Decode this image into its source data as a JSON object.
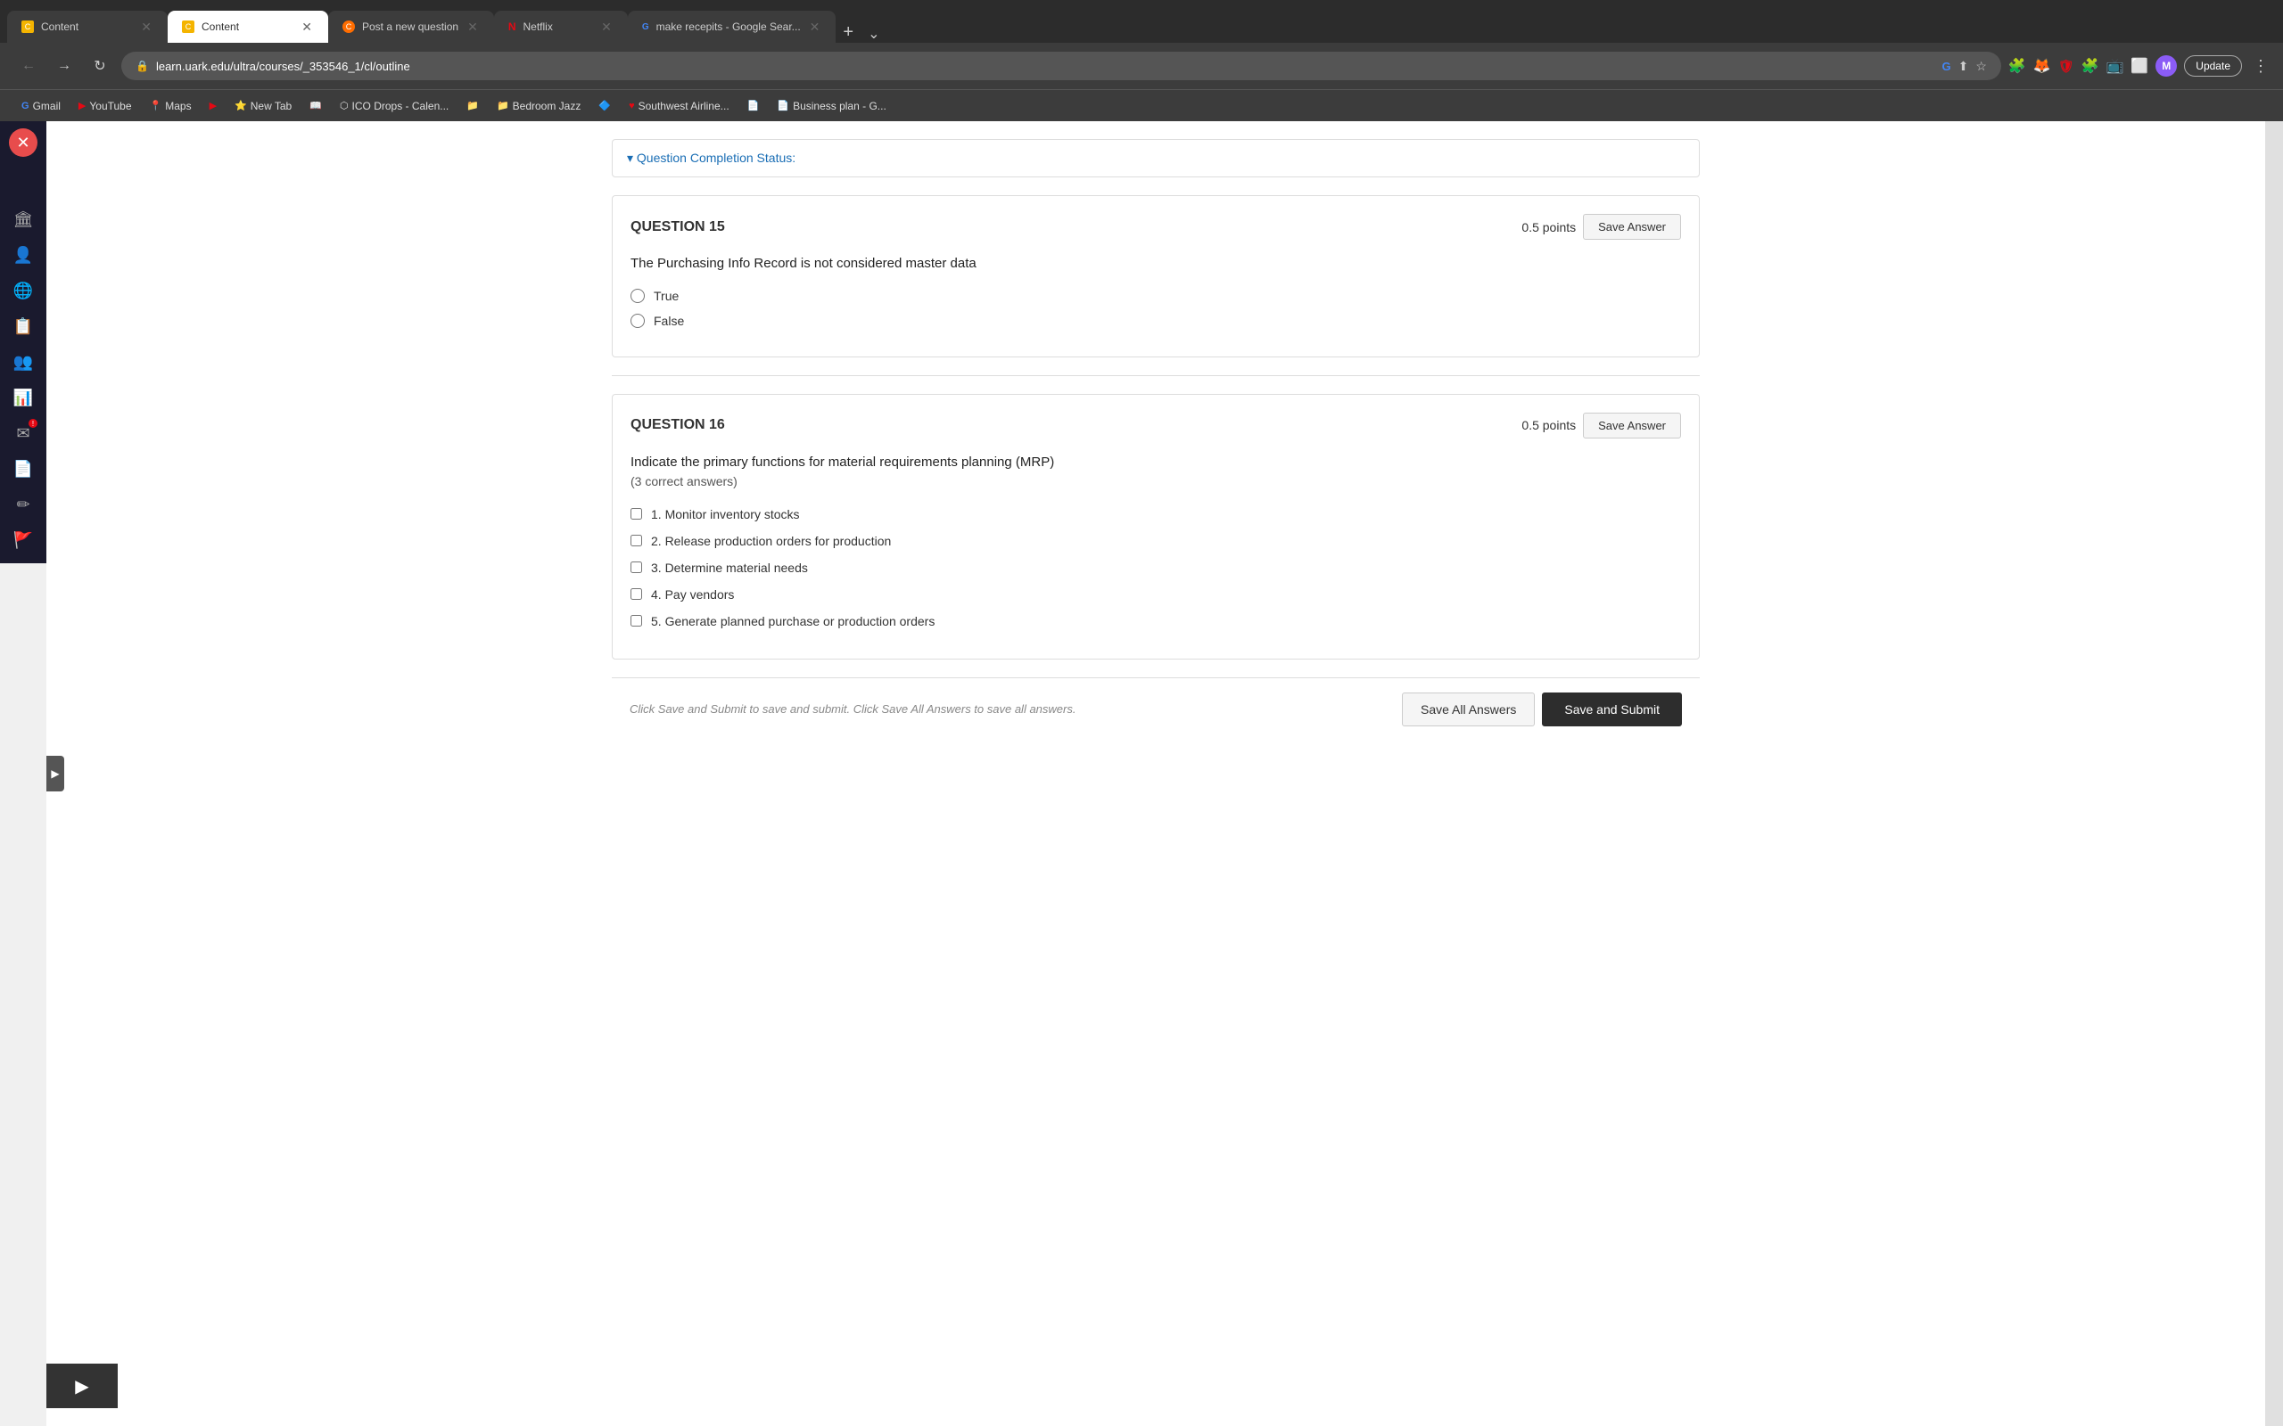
{
  "browser": {
    "tabs": [
      {
        "id": "tab1",
        "label": "Content",
        "active": false,
        "favicon_color": "#f4b400",
        "favicon_letter": "C"
      },
      {
        "id": "tab2",
        "label": "Content",
        "active": true,
        "favicon_color": "#f4b400",
        "favicon_letter": "C"
      },
      {
        "id": "tab3",
        "label": "Post a new question",
        "active": false,
        "favicon_color": "#ff6d00",
        "favicon_letter": "C"
      },
      {
        "id": "tab4",
        "label": "Netflix",
        "active": false,
        "favicon_color": "#e50914",
        "favicon_letter": "N"
      },
      {
        "id": "tab5",
        "label": "make recepits - Google Sear...",
        "active": false,
        "favicon_color": "#4285f4",
        "favicon_letter": "G"
      }
    ],
    "address": "learn.uark.edu/ultra/courses/_353546_1/cl/outline",
    "bookmarks": [
      {
        "label": "Gmail",
        "icon": "G"
      },
      {
        "label": "YouTube",
        "icon": "▶"
      },
      {
        "label": "Maps",
        "icon": "📍"
      },
      {
        "label": "",
        "icon": "▶"
      },
      {
        "label": "New Tab",
        "icon": "⭐"
      },
      {
        "label": "",
        "icon": "📖"
      },
      {
        "label": "ICO Drops - Calen...",
        "icon": "⬡"
      },
      {
        "label": "",
        "icon": "📁"
      },
      {
        "label": "Bedroom Jazz",
        "icon": "📁"
      },
      {
        "label": "",
        "icon": "🔷"
      },
      {
        "label": "Southwest Airline...",
        "icon": "♥"
      },
      {
        "label": "",
        "icon": "📄"
      },
      {
        "label": "Business plan - G...",
        "icon": "📄"
      }
    ]
  },
  "sidebar": {
    "icons": [
      "✕",
      "🏛",
      "👤",
      "🌐",
      "📋",
      "👥",
      "📊",
      "✉",
      "📄",
      "✏",
      "🚩"
    ]
  },
  "completion_status": {
    "title": "Question Completion Status:"
  },
  "question15": {
    "number": "QUESTION 15",
    "points": "0.5 points",
    "save_btn": "Save Answer",
    "text": "The Purchasing Info Record is not considered master data",
    "options": [
      {
        "label": "True",
        "type": "radio"
      },
      {
        "label": "False",
        "type": "radio"
      }
    ]
  },
  "question16": {
    "number": "QUESTION 16",
    "points": "0.5 points",
    "save_btn": "Save Answer",
    "text": "Indicate the primary functions for material requirements planning (MRP)",
    "subtext": "(3 correct answers)",
    "options": [
      {
        "label": "1. Monitor inventory stocks",
        "type": "checkbox"
      },
      {
        "label": "2. Release production orders for production",
        "type": "checkbox"
      },
      {
        "label": "3. Determine material needs",
        "type": "checkbox"
      },
      {
        "label": "4. Pay vendors",
        "type": "checkbox"
      },
      {
        "label": "5. Generate planned purchase or production orders",
        "type": "checkbox"
      }
    ]
  },
  "footer": {
    "text": "Click Save and Submit to save and submit. Click Save All Answers to save all answers.",
    "save_all_btn": "Save All Answers",
    "save_submit_btn": "Save and Submit"
  },
  "expand_arrow": "▶",
  "back_btn": "←",
  "forward_btn": "→",
  "reload_btn": "↻",
  "update_btn": "Update"
}
